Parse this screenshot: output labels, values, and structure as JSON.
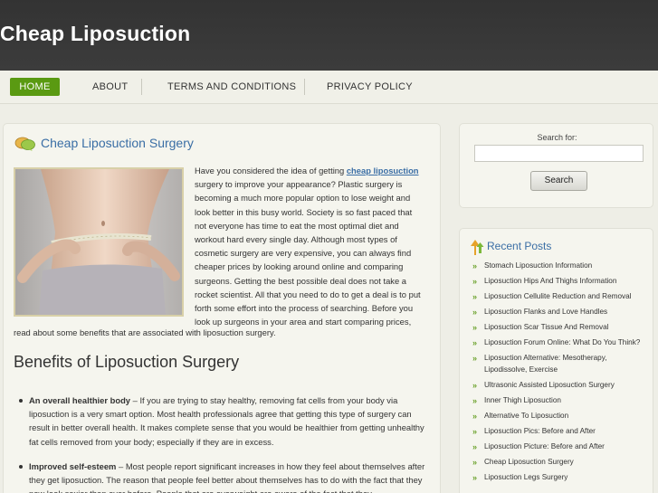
{
  "site": {
    "title": "Cheap Liposuction"
  },
  "nav": {
    "items": [
      {
        "label": "HOME"
      },
      {
        "label": "ABOUT"
      },
      {
        "label": "TERMS AND CONDITIONS"
      },
      {
        "label": "PRIVACY POLICY"
      }
    ]
  },
  "post": {
    "title": "Cheap Liposuction Surgery",
    "intro_before_link": "Have you considered the idea of getting ",
    "intro_link": "cheap liposuction",
    "intro_lines": [
      "surgery to improve your appearance? Plastic surgery is",
      "becoming a much more popular option to lose weight and",
      "look better in this busy world. Society is so fast paced that",
      "not everyone has time to eat the most optimal diet and",
      "workout hard every single day. Although most types of",
      "cosmetic surgery are very expensive, you can always find",
      "cheaper prices by looking around online and comparing",
      "surgeons. Getting the best possible deal does not take a",
      "rocket scientist. All that you need to do to get a deal is to put",
      "forth some effort into the process of searching. Before you",
      "look up surgeons in your area and start comparing prices,"
    ],
    "intro_last": "read about some benefits that are associated with liposuction surgery.",
    "subheading": "Benefits of Liposuction Surgery",
    "benefits": [
      {
        "title": "An overall healthier body",
        "text": " – If you are trying to stay healthy, removing fat cells from your body via liposuction is a very smart option. Most health professionals agree that getting this type of surgery can result in better overall health. It makes complete sense that you would be healthier from getting unhealthy fat cells removed from your body; especially if they are in excess."
      },
      {
        "title": "Improved self-esteem",
        "text": " – Most people report significant increases in how they feel about themselves after they get liposuction. The reason that people feel better about themselves has to do with the fact that they now look sexier than ever before. People that are overweight are aware of the fact that they"
      }
    ]
  },
  "sidebar": {
    "search": {
      "label": "Search for:",
      "placeholder": "",
      "button": "Search"
    },
    "recent": {
      "title": "Recent Posts",
      "items": [
        "Stomach Liposuction Information",
        "Liposuction Hips And Thighs Information",
        "Liposuction Cellulite Reduction and Removal",
        "Liposuction Flanks and Love Handles",
        "Liposuction Scar Tissue And Removal",
        "Liposuction Forum Online: What Do You Think?",
        "Liposuction Alternative: Mesotherapy, Lipodissolve, Exercise",
        "Ultrasonic Assisted Liposuction Surgery",
        "Inner Thigh Liposuction",
        "Alternative To Liposuction",
        "Liposuction Pics: Before and After",
        "Liposuction Picture: Before and After",
        "Cheap Liposuction Surgery",
        "Liposuction Legs Surgery"
      ]
    }
  },
  "colors": {
    "accent": "#5a9a12",
    "link": "#3a6ea5",
    "header": "#333333"
  }
}
